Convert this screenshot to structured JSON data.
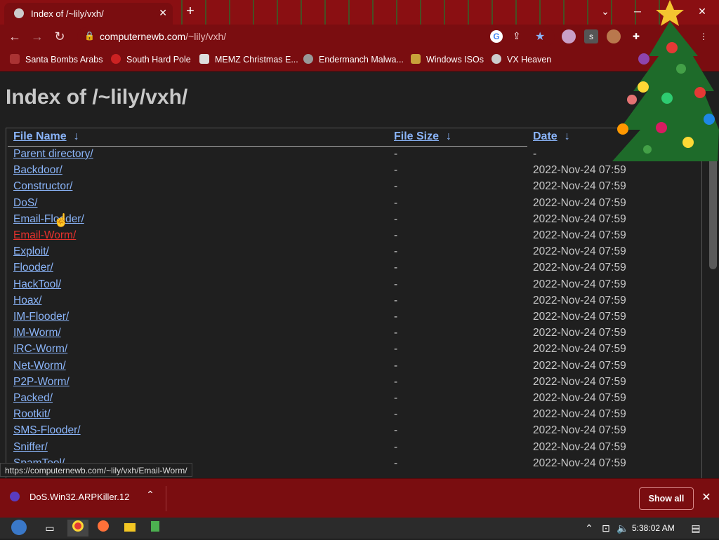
{
  "browser": {
    "tab_title": "Index of /~lily/vxh/",
    "close_tab": "✕",
    "new_tab": "+",
    "url_domain": "computernewb.com",
    "url_path": "/~lily/vxh/",
    "bookmarks": [
      {
        "label": "Santa Bombs Arabs"
      },
      {
        "label": "South Hard Pole"
      },
      {
        "label": "MEMZ Christmas E..."
      },
      {
        "label": "Endermanch Malwa..."
      },
      {
        "label": "Windows ISOs"
      },
      {
        "label": "VX Heaven"
      }
    ],
    "status_url": "https://computernewb.com/~lily/vxh/Email-Worm/"
  },
  "page": {
    "heading": "Index of /~lily/vxh/",
    "columns": {
      "name": "File Name",
      "size": "File Size",
      "date": "Date",
      "sort_arrow": "↓"
    },
    "rows": [
      {
        "name": "Parent directory/",
        "size": "-",
        "date": "-"
      },
      {
        "name": "Backdoor/",
        "size": "-",
        "date": "2022-Nov-24 07:59"
      },
      {
        "name": "Constructor/",
        "size": "-",
        "date": "2022-Nov-24 07:59"
      },
      {
        "name": "DoS/",
        "size": "-",
        "date": "2022-Nov-24 07:59"
      },
      {
        "name": "Email-Flooder/",
        "size": "-",
        "date": "2022-Nov-24 07:59"
      },
      {
        "name": "Email-Worm/",
        "size": "-",
        "date": "2022-Nov-24 07:59"
      },
      {
        "name": "Exploit/",
        "size": "-",
        "date": "2022-Nov-24 07:59"
      },
      {
        "name": "Flooder/",
        "size": "-",
        "date": "2022-Nov-24 07:59"
      },
      {
        "name": "HackTool/",
        "size": "-",
        "date": "2022-Nov-24 07:59"
      },
      {
        "name": "Hoax/",
        "size": "-",
        "date": "2022-Nov-24 07:59"
      },
      {
        "name": "IM-Flooder/",
        "size": "-",
        "date": "2022-Nov-24 07:59"
      },
      {
        "name": "IM-Worm/",
        "size": "-",
        "date": "2022-Nov-24 07:59"
      },
      {
        "name": "IRC-Worm/",
        "size": "-",
        "date": "2022-Nov-24 07:59"
      },
      {
        "name": "Net-Worm/",
        "size": "-",
        "date": "2022-Nov-24 07:59"
      },
      {
        "name": "P2P-Worm/",
        "size": "-",
        "date": "2022-Nov-24 07:59"
      },
      {
        "name": "Packed/",
        "size": "-",
        "date": "2022-Nov-24 07:59"
      },
      {
        "name": "Rootkit/",
        "size": "-",
        "date": "2022-Nov-24 07:59"
      },
      {
        "name": "SMS-Flooder/",
        "size": "-",
        "date": "2022-Nov-24 07:59"
      },
      {
        "name": "Sniffer/",
        "size": "-",
        "date": "2022-Nov-24 07:59"
      },
      {
        "name": "SpamTool/",
        "size": "-",
        "date": "2022-Nov-24 07:59"
      }
    ]
  },
  "downloads": {
    "file": "DoS.Win32.ARPKiller.12",
    "show_all": "Show all"
  },
  "taskbar": {
    "clock": "5:38:02 AM"
  },
  "colors": {
    "accent": "#8a0f12",
    "link": "#8ab4f8",
    "link_hover": "#e8322d"
  }
}
